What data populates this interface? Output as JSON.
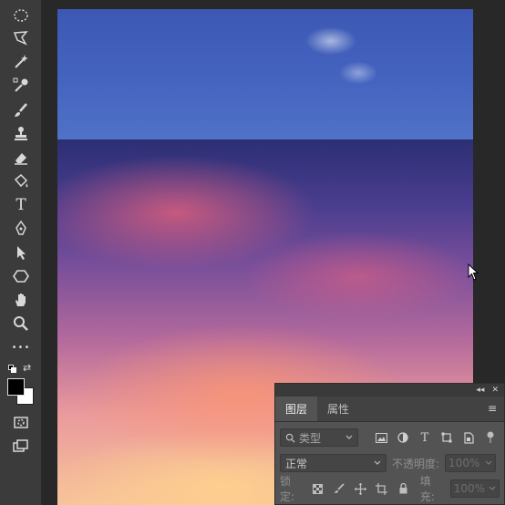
{
  "toolbar": {
    "tools": [
      {
        "name": "elliptical-marquee-tool",
        "icon": "ellipse-select-icon"
      },
      {
        "name": "lasso-tool",
        "icon": "polygon-lasso-icon"
      },
      {
        "name": "magic-wand-tool",
        "icon": "magic-wand-icon"
      },
      {
        "name": "eyedropper-tool",
        "icon": "eyedropper-icon"
      },
      {
        "name": "brush-tool",
        "icon": "brush-icon"
      },
      {
        "name": "stamp-tool",
        "icon": "stamp-icon"
      },
      {
        "name": "eraser-tool",
        "icon": "eraser-icon"
      },
      {
        "name": "paint-bucket-tool",
        "icon": "bucket-icon"
      },
      {
        "name": "type-tool",
        "icon": "type-icon",
        "glyph": "T"
      },
      {
        "name": "pen-tool",
        "icon": "pen-icon"
      },
      {
        "name": "path-selection-tool",
        "icon": "arrow-icon"
      },
      {
        "name": "shape-tool",
        "icon": "hexagon-icon"
      },
      {
        "name": "hand-tool",
        "icon": "hand-icon"
      },
      {
        "name": "zoom-tool",
        "icon": "zoom-icon"
      },
      {
        "name": "more-tools",
        "icon": "more-icon",
        "glyph": "•••"
      }
    ],
    "foreground_color": "#000000",
    "background_color": "#ffffff"
  },
  "layers_panel": {
    "tabs": [
      {
        "label": "图层",
        "active": true
      },
      {
        "label": "属性",
        "active": false
      }
    ],
    "filter": {
      "label": "类型"
    },
    "blend_mode": "正常",
    "opacity_label": "不透明度:",
    "opacity_value": "100%",
    "lock_label": "锁定:",
    "fill_label": "填充:",
    "fill_value": "100%",
    "collapse_label": "◂◂",
    "close_label": "✕",
    "menu_label": "≡"
  },
  "canvas": {
    "sky_color": "#4463c0",
    "sunset_color": "#ea9a9c"
  }
}
